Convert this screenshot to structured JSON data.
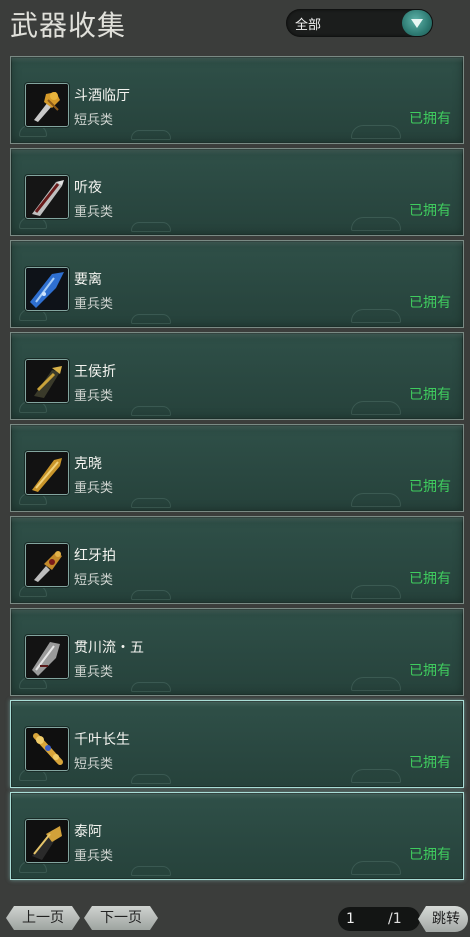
{
  "header": {
    "title": "武器收集",
    "filter_value": "全部"
  },
  "weapons": [
    {
      "name": "斗酒临厅",
      "type": "短兵类",
      "status": "已拥有",
      "icon": "golden-dagger-icon"
    },
    {
      "name": "听夜",
      "type": "重兵类",
      "status": "已拥有",
      "icon": "silver-blade-icon"
    },
    {
      "name": "要离",
      "type": "重兵类",
      "status": "已拥有",
      "icon": "blue-blade-icon"
    },
    {
      "name": "王侯折",
      "type": "重兵类",
      "status": "已拥有",
      "icon": "dark-gold-blade-icon"
    },
    {
      "name": "克晓",
      "type": "重兵类",
      "status": "已拥有",
      "icon": "gold-blade-icon"
    },
    {
      "name": "红牙拍",
      "type": "短兵类",
      "status": "已拥有",
      "icon": "ornate-dagger-icon"
    },
    {
      "name": "贯川流・五",
      "type": "重兵类",
      "status": "已拥有",
      "icon": "steel-blade-icon"
    },
    {
      "name": "千叶长生",
      "type": "短兵类",
      "status": "已拥有",
      "icon": "golden-rod-icon"
    },
    {
      "name": "泰阿",
      "type": "重兵类",
      "status": "已拥有",
      "icon": "black-gold-blade-icon"
    }
  ],
  "footer": {
    "prev_label": "上一页",
    "next_label": "下一页",
    "page_current": "1",
    "page_total": "/1",
    "jump_label": "跳转"
  },
  "colors": {
    "owned": "#3fcb5e",
    "card_bg": "#2a4841",
    "accent": "#2d7a72"
  }
}
